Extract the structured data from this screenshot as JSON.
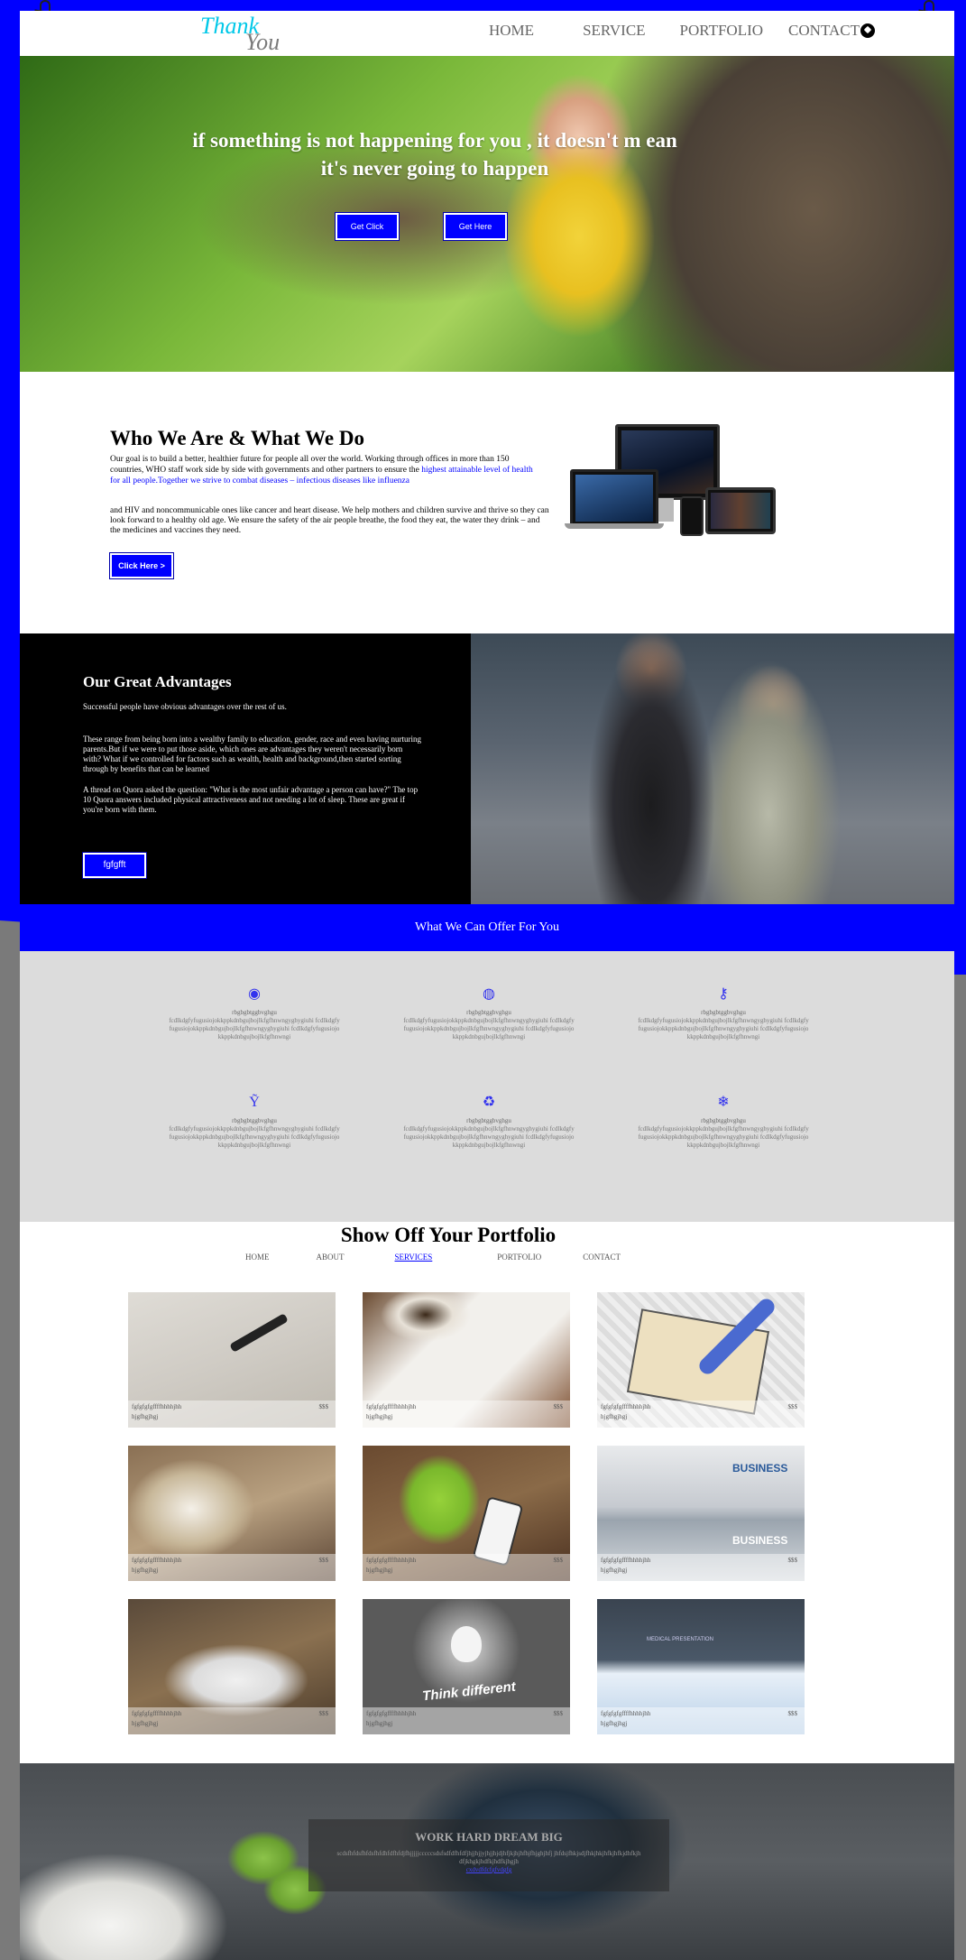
{
  "nav": {
    "logo_top": "Thank",
    "logo_bottom": "You",
    "links": [
      "HOME",
      "SERVICE",
      "PORTFOLIO",
      "CONTACT"
    ]
  },
  "hero": {
    "title": "if something is not happening for you , it doesn't m ean it's never going to happen",
    "btn1": "Get Click",
    "btn2": "Get Here"
  },
  "who": {
    "title": "Who We Are & What We Do",
    "p1": "Our goal is to build a better, healthier future for people all over the world. Working through offices in more than 150 countries, WHO staff work side by side with governments and other partners to ensure the",
    "p1_hl": "highest attainable level of health for all people.Together we strive to combat diseases – infectious diseases like influenza",
    "p2": "and HIV and noncommunicable ones like cancer and heart disease. We help mothers and children survive and thrive so they can look forward to a healthy old age. We ensure the safety of the air people breathe, the food they eat, the water they drink – and the medicines and vaccines they need.",
    "btn": "Click Here >"
  },
  "advantages": {
    "title": "Our Great Advantages",
    "subtitle": "Successful people have obvious advantages over the rest of us.",
    "p1": "These range from being born into a wealthy family to education, gender, race and even having nurturing parents.But if we were to put those aside, which ones are advantages they weren't necessarily born with? What if we controlled for factors such as wealth, health and background,then started sorting through by benefits that can be learned",
    "p2": "A thread on Quora asked the question: \"What is the most unfair advantage a person can have?\" The top 10 Quora answers included physical attractiveness and not needing a lot of sleep. These are great if you're born with them.",
    "btn": "fgfgfft"
  },
  "offer": {
    "title": "What We Can Offer For You",
    "items": [
      {
        "icon": "circle-icon",
        "glyph": "◉",
        "t": "rbgbgbtggbvghgu",
        "d": "fcdlkdgfyfugusiojokkppkdnbgujbojlkfgfhnwngyghygiuhi fcdlkdgfyfugusiojokkppkdnbgujbojlkfgfhnwngyghygiuhi fcdlkdgfyfugusiojokkppkdnbgujbojlkfgfhnwngi"
      },
      {
        "icon": "compass-icon",
        "glyph": "◍",
        "t": "rbgbgbtggbvghgu",
        "d": "fcdlkdgfyfugusiojokkppkdnbgujbojlkfgfhnwngyghygiuhi fcdlkdgfyfugusiojokkppkdnbgujbojlkfgfhnwngyghygiuhi fcdlkdgfyfugusiojokkppkdnbgujbojlkfgfhnwngi"
      },
      {
        "icon": "key-icon",
        "glyph": "⚷",
        "t": "rbgbgbtggbvghgu",
        "d": "fcdlkdgfyfugusiojokkppkdnbgujbojlkfgfhnwngyghygiuhi fcdlkdgfyfugusiojokkppkdnbgujbojlkfgfhnwngyghygiuhi fcdlkdgfyfugusiojokkppkdnbgujbojlkfgfhnwngi"
      },
      {
        "icon": "cocktail-icon",
        "glyph": "Ỹ",
        "t": "rbgbgbtggbvghgu",
        "d": "fcdlkdgfyfugusiojokkppkdnbgujbojlkfgfhnwngyghygiuhi fcdlkdgfyfugusiojokkppkdnbgujbojlkfgfhnwngyghygiuhi fcdlkdgfyfugusiojokkppkdnbgujbojlkfgfhnwngi"
      },
      {
        "icon": "recycle-icon",
        "glyph": "♻",
        "t": "rbgbgbtggbvghgu",
        "d": "fcdlkdgfyfugusiojokkppkdnbgujbojlkfgfhnwngyghygiuhi fcdlkdgfyfugusiojokkppkdnbgujbojlkfgfhnwngyghygiuhi fcdlkdgfyfugusiojokkppkdnbgujbojlkfgfhnwngi"
      },
      {
        "icon": "snowflake-icon",
        "glyph": "❄",
        "t": "rbgbgbtggbvghgu",
        "d": "fcdlkdgfyfugusiojokkppkdnbgujbojlkfgfhnwngyghygiuhi fcdlkdgfyfugusiojokkppkdnbgujbojlkfgfhnwngyghygiuhi fcdlkdgfyfugusiojokkppkdnbgujbojlkfgfhnwngi"
      }
    ]
  },
  "portfolio": {
    "title": "Show Off Your Portfolio",
    "tabs": [
      "HOME",
      "ABOUT",
      "SERVICES",
      "PORTFOLIO",
      "CONTACT"
    ],
    "active_tab": "SERVICES",
    "cards": [
      {
        "name": "fgfgfgfgffffhhhhjhh",
        "price": "$$$",
        "sub": "hjgfhgjhgj"
      },
      {
        "name": "fgfgfgfgffffhhhhjhh",
        "price": "$$$",
        "sub": "hjgfhgjhgj"
      },
      {
        "name": "fgfgfgfgffffhhhhjhh",
        "price": "$$$",
        "sub": "hjgfhgjhgj"
      },
      {
        "name": "fgfgfgfgffffhhhhjhh",
        "price": "$$$",
        "sub": "hjgfhgjhgj"
      },
      {
        "name": "fgfgfgfgffffhhhhjhh",
        "price": "$$$",
        "sub": "hjgfhgjhgj"
      },
      {
        "name": "fgfgfgfgffffhhhhjhh",
        "price": "$$$",
        "sub": "hjgfhgjhgj"
      },
      {
        "name": "fgfgfgfgffffhhhhjhh",
        "price": "$$$",
        "sub": "hjgfhgjhgj"
      },
      {
        "name": "fgfgfgfgffffhhhhjhh",
        "price": "$$$",
        "sub": "hjgfhgjhgj"
      },
      {
        "name": "fgfgfgfgffffhhhhjhh",
        "price": "$$$",
        "sub": "hjgfhgjhgj"
      }
    ],
    "card6_text": "BUSINESS",
    "card8_text": "Think different",
    "card9_text": "MEDICAL PRESENTATION"
  },
  "footer": {
    "title": "WORK HARD DREAM BIG",
    "text": "scdsfhfdsfhfdsfhfdhfdfhfdjfhjjjjjcccccsdsfsdfdfhfdfjhjjhjjyjhjjhjdjhfjkjhjhfhjfhjghjhfj jhfdsjfhkjsdjfhkjhkjhfkjhfkjdhfkjhdfjkhgkjhdfkjhdfkjhgjh",
    "link": "cxdvdfdcfgfvdgfg"
  },
  "colors": {
    "accent": "#0000ff",
    "logo_thank": "#00c8e8",
    "logo_you": "#7a7a7a",
    "offer_bg": "#dcdcdc"
  }
}
